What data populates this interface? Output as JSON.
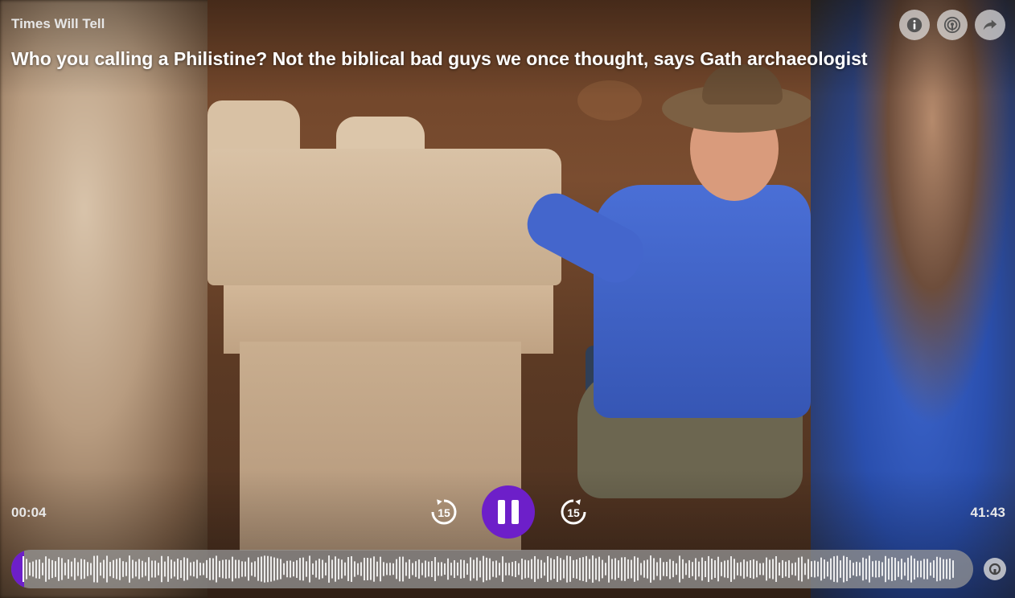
{
  "player": {
    "show_name": "Times Will Tell",
    "episode_title": "Who you calling a Philistine? Not the biblical bad guys we once thought, says Gath archaeologist",
    "time_elapsed": "00:04",
    "time_total": "41:43",
    "skip_back_label": "15",
    "skip_forward_label": "15",
    "state": "playing",
    "progress_fraction": 0.0016
  },
  "top_buttons": {
    "info_icon": "info-icon",
    "podcast_icon": "podcast-icon",
    "share_icon": "share-icon"
  },
  "colors": {
    "accent": "#6d1fc9",
    "button_bg": "#e6e6e6",
    "text_primary": "#ffffff",
    "text_secondary": "#e6e6e6"
  }
}
